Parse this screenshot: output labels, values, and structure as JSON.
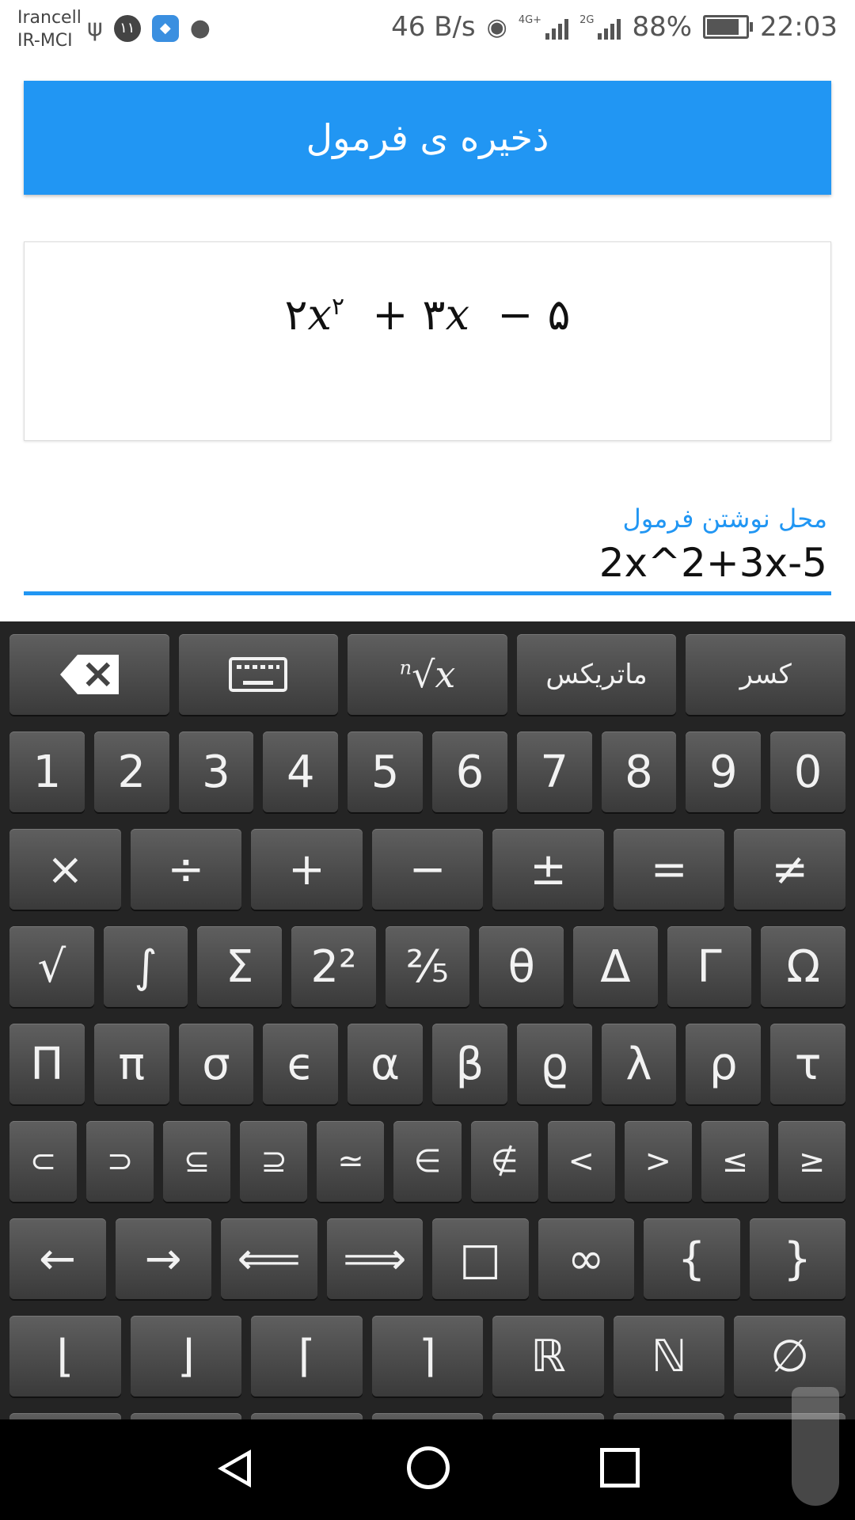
{
  "status_bar": {
    "carrier_line1": "Irancell",
    "carrier_line2": "IR-MCI",
    "notif_badge": "۱۱",
    "net_speed": "46 B/s",
    "net_type_1": "4G+",
    "net_type_2": "2G",
    "battery": "88%",
    "time": "22:03"
  },
  "save_button": {
    "label": "ذخیره ی فرمول"
  },
  "preview": {
    "coef1": "۲",
    "var": "x",
    "exp": "۲",
    "op1": "+",
    "coef2": "۳",
    "op2": "−",
    "const": "۵"
  },
  "formula_input": {
    "label": "محل نوشتن فرمول",
    "value": "2x^2+3x-5"
  },
  "keyboard": {
    "row1": {
      "root_index": "n",
      "root_radicand": "x",
      "matrix": "ماتریکس",
      "fraction": "کسر"
    },
    "digits": [
      "1",
      "2",
      "3",
      "4",
      "5",
      "6",
      "7",
      "8",
      "9",
      "0"
    ],
    "operators": [
      "×",
      "÷",
      "+",
      "−",
      "±",
      "=",
      "≠"
    ],
    "row4": [
      "√",
      "∫",
      "Σ",
      "2²",
      "⅖",
      "θ",
      "Δ",
      "Γ",
      "Ω"
    ],
    "greek": [
      "Π",
      "π",
      "σ",
      "ϵ",
      "α",
      "β",
      "ϱ",
      "λ",
      "ρ",
      "τ"
    ],
    "sets": [
      "⊂",
      "⊃",
      "⊆",
      "⊇",
      "≃",
      "∈",
      "∉",
      "<",
      ">",
      "≤",
      "≥"
    ],
    "arrows": [
      "←",
      "→",
      "⟸",
      "⟹",
      "□",
      "∞",
      "{",
      "}"
    ],
    "misc": [
      "⌊",
      "⌋",
      "⌈",
      "⌉",
      "ℝ",
      "ℕ",
      "∅"
    ]
  }
}
